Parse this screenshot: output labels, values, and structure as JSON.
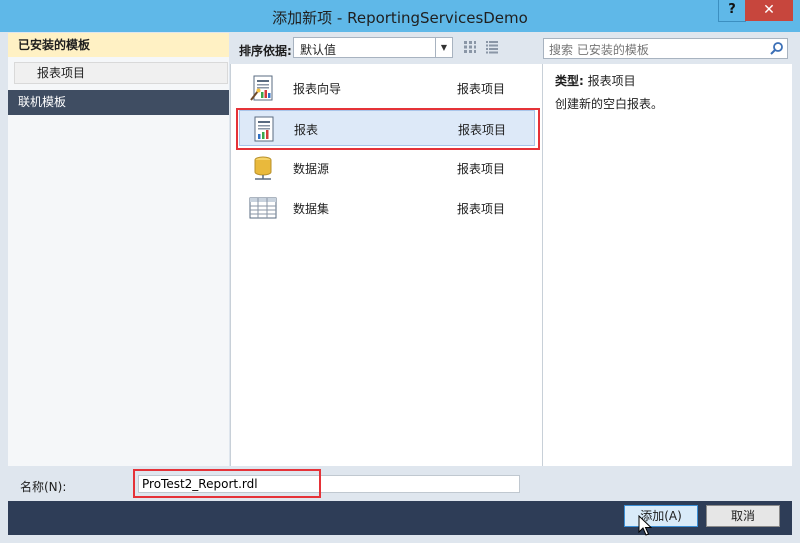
{
  "window": {
    "title": "添加新项 - ReportingServicesDemo",
    "help_label": "?",
    "close_label": "✕"
  },
  "left_pane": {
    "installed_header": "已安装的模板",
    "report_items_node": "报表项目",
    "online_header": "联机模板"
  },
  "toolbar": {
    "sort_label": "排序依据:",
    "sort_value": "默认值"
  },
  "search": {
    "placeholder": "搜索 已安装的模板"
  },
  "items": [
    {
      "name": "报表向导",
      "category": "报表项目",
      "icon": "report-wizard-icon",
      "selected": false
    },
    {
      "name": "报表",
      "category": "报表项目",
      "icon": "report-icon",
      "selected": true
    },
    {
      "name": "数据源",
      "category": "报表项目",
      "icon": "data-source-icon",
      "selected": false
    },
    {
      "name": "数据集",
      "category": "报表项目",
      "icon": "dataset-icon",
      "selected": false
    }
  ],
  "description": {
    "type_label": "类型:",
    "type_value": "报表项目",
    "text": "创建新的空白报表。"
  },
  "name_row": {
    "label": "名称(N):",
    "value": "ProTest2_Report.rdl"
  },
  "buttons": {
    "add": "添加(A)",
    "cancel": "取消"
  },
  "colors": {
    "titlebar": "#5fb8e8",
    "close": "#c7463d",
    "selected_bg": "#dde9f8",
    "highlight": "#e53238",
    "bottom_bar": "#2e3d57"
  }
}
